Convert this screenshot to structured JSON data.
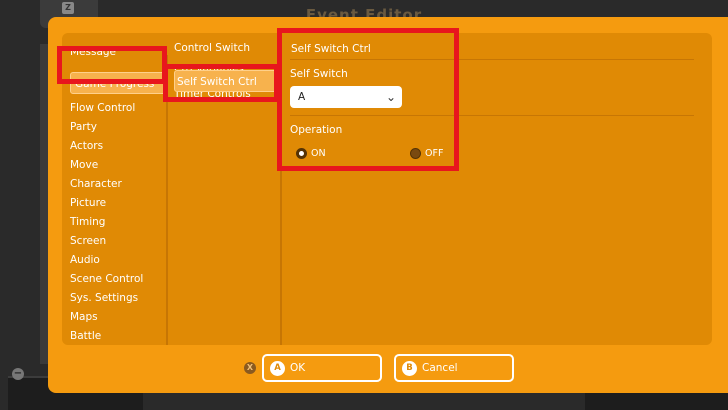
{
  "background": {
    "title": "Event Editor",
    "tab_icon": "Z",
    "minus_icon": "−"
  },
  "menu": {
    "first": "Message",
    "selected": "Game Progress",
    "items": [
      "Flow Control",
      "Party",
      "Actors",
      "Move",
      "Character",
      "Picture",
      "Timing",
      "Screen",
      "Audio",
      "Scene Control",
      "Sys. Settings",
      "Maps",
      "Battle"
    ]
  },
  "submenu": {
    "items": [
      "Control Switch",
      "Ctrl Variables"
    ],
    "selected": "Self Switch Ctrl",
    "after": "Timer Controls"
  },
  "detail": {
    "title": "Self Switch Ctrl",
    "self_switch_label": "Self Switch",
    "self_switch_value": "A",
    "operation_label": "Operation",
    "on_label": "ON",
    "off_label": "OFF"
  },
  "footer": {
    "x_key": "X",
    "ok_key": "A",
    "ok_label": "OK",
    "cancel_key": "B",
    "cancel_label": "Cancel"
  },
  "colors": {
    "accent": "#f59b0f",
    "panel": "#e08a05",
    "highlight": "#f7b24d",
    "annotation_red": "#e8161d"
  }
}
